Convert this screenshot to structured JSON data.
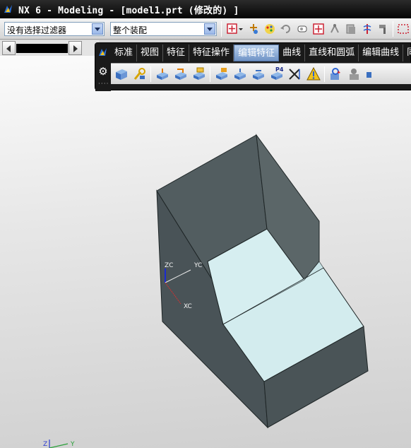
{
  "window": {
    "title": "NX 6 - Modeling - [model1.prt (修改的) ]",
    "logo_icon": "nx-logo-icon"
  },
  "filterbar": {
    "filter_value": "没有选择过滤器",
    "assembly_value": "整个装配",
    "icons": [
      "point-snap-icon",
      "snap-arrow-icon",
      "quick-pick-icon",
      "color-palette-icon",
      "undo-icon",
      "eraser-icon",
      "crosshair-target-icon",
      "move-node-icon",
      "copy-icon",
      "spring-arrow-icon",
      "hammer-icon",
      "selection-box-icon"
    ]
  },
  "ribbon": {
    "tabs": [
      "标准",
      "视图",
      "特征",
      "特征操作",
      "编辑特征",
      "曲线",
      "直线和圆弧",
      "编辑曲线",
      "同步"
    ],
    "active_tab": "编辑特征",
    "icons": [
      "edit-parameters-icon",
      "feature-dimension-icon",
      "edit-positioning-icon",
      "move-feature-icon",
      "reorder-feature-icon",
      "replace-feature-icon",
      "suppress-feature-icon",
      "unsuppress-feature-icon",
      "expression-p4-icon",
      "remove-parameters-icon",
      "delayed-update-icon",
      "update-model-icon",
      "playback-icon"
    ],
    "expression_label": "P4"
  },
  "viewport": {
    "wcs_labels": {
      "zc": "ZC",
      "yc": "YC",
      "xc": "XC"
    },
    "triad_labels": {
      "z": "Z",
      "y": "Y"
    },
    "colors": {
      "wall_front": "#495357",
      "wall_side": "#5b6668",
      "inner_face": "#d6eef0",
      "edge": "#1e2526",
      "background_top": "#fbfbfb",
      "background_bottom": "#cfcfcf"
    }
  }
}
